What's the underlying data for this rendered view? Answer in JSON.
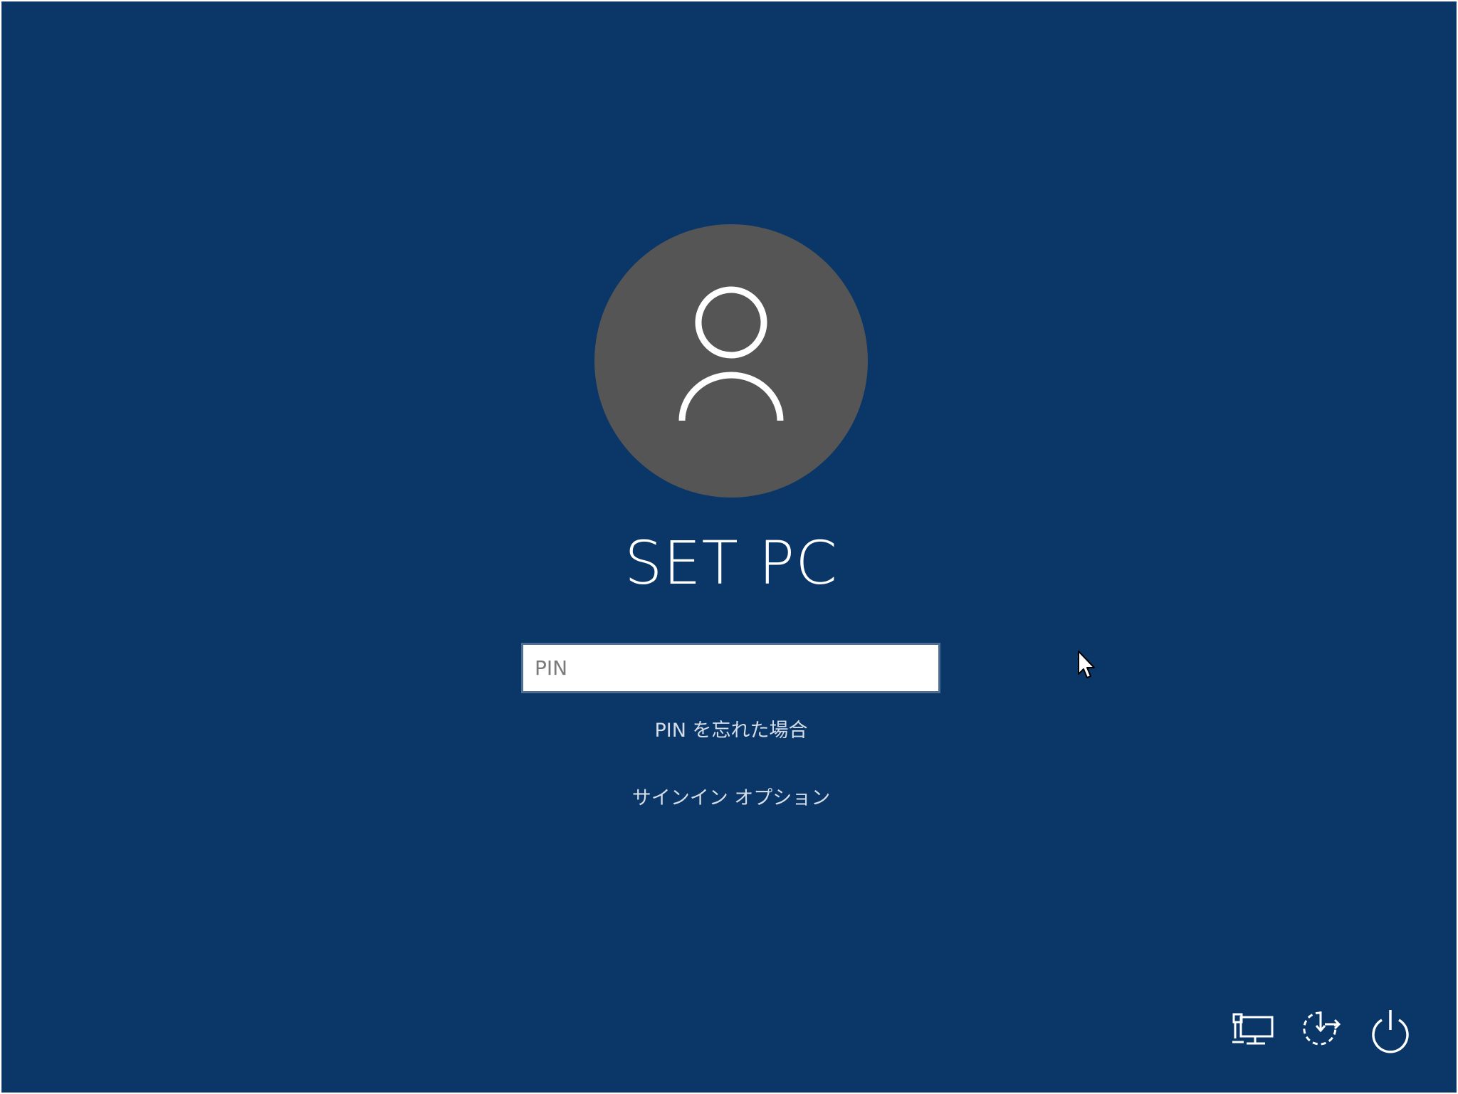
{
  "screen": {
    "background_color": "#0a3767"
  },
  "user": {
    "name": "SET PC",
    "avatar_icon": "user-silhouette-icon",
    "avatar_color": "#555555"
  },
  "login": {
    "pin_placeholder": "PIN",
    "pin_value": "",
    "forgot_pin_label": "PIN を忘れた場合",
    "signin_options_label": "サインイン オプション"
  },
  "corner_buttons": [
    {
      "icon": "network-icon"
    },
    {
      "icon": "ease-of-access-icon"
    },
    {
      "icon": "power-icon"
    }
  ]
}
